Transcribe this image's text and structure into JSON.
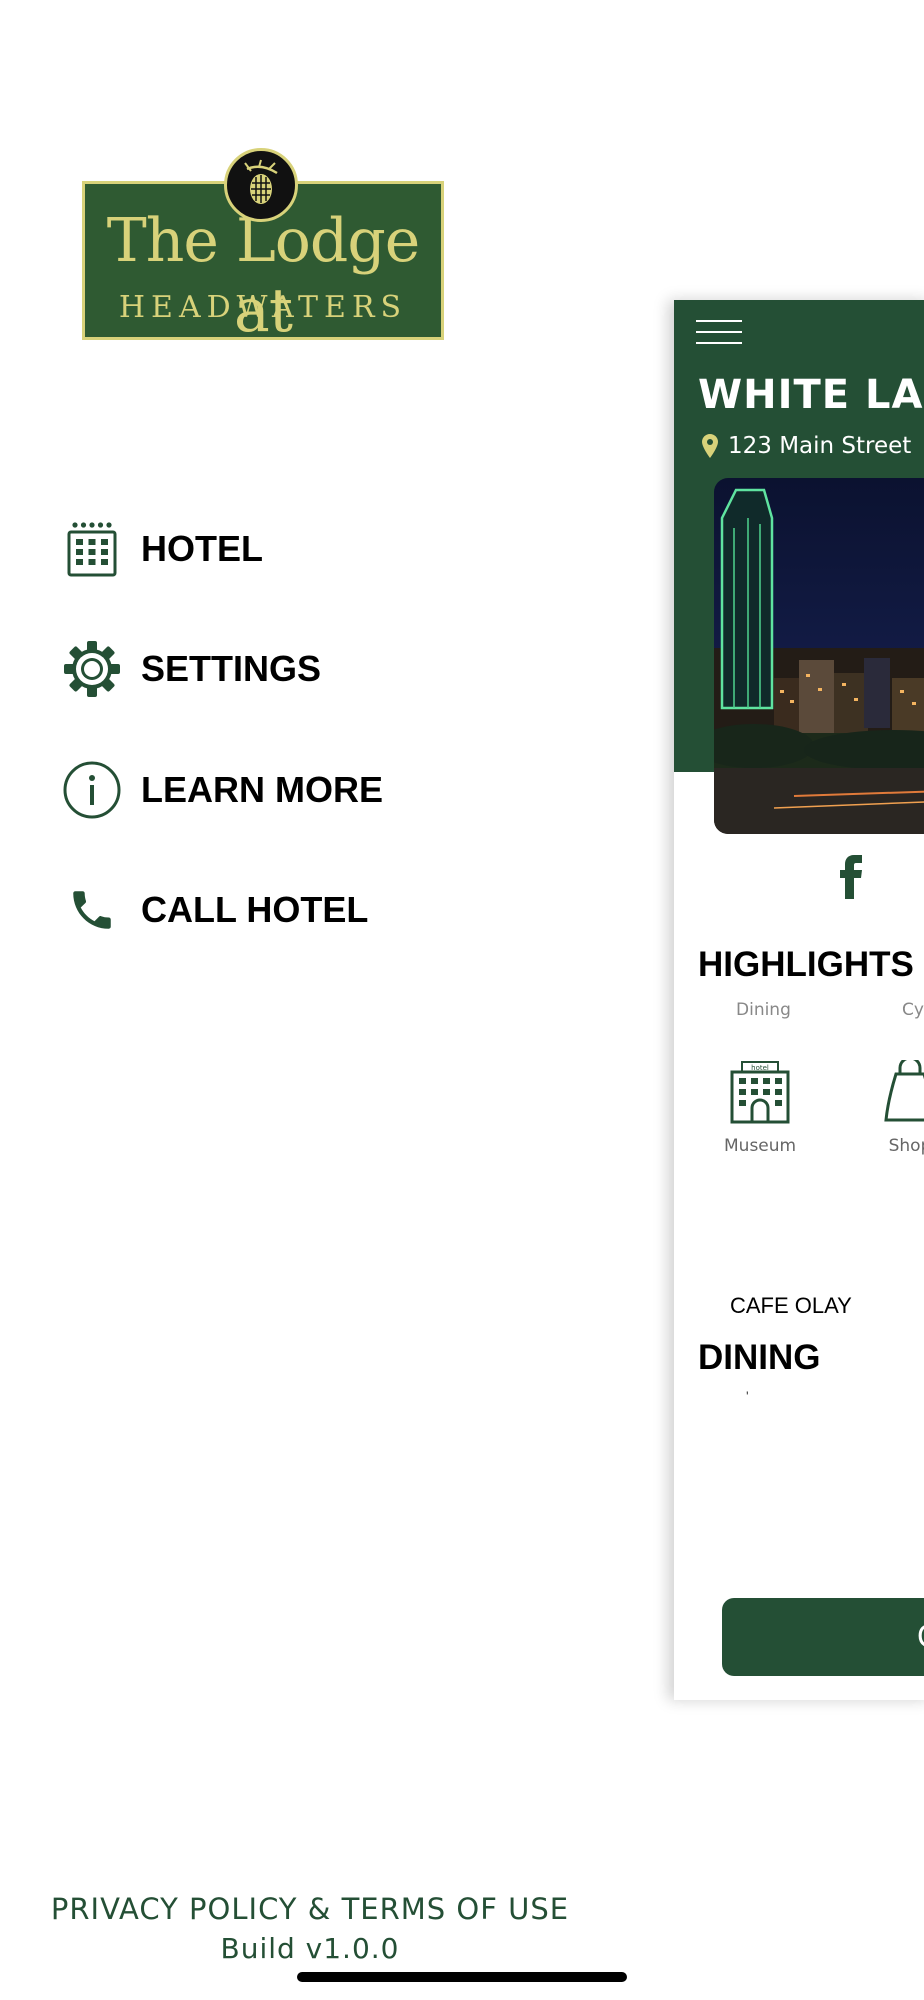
{
  "logo": {
    "line1": "The Lodge at",
    "line2": "HEADWATERS"
  },
  "menu": {
    "items": [
      {
        "label": "HOTEL",
        "icon": "hotel-building-icon"
      },
      {
        "label": "SETTINGS",
        "icon": "gear-icon"
      },
      {
        "label": "LEARN MORE",
        "icon": "info-icon"
      },
      {
        "label": "CALL HOTEL",
        "icon": "phone-icon"
      }
    ]
  },
  "footer": {
    "privacy": "PRIVACY POLICY",
    "amp": "&",
    "terms": "TERMS OF USE",
    "build": "Build v1.0.0"
  },
  "panel": {
    "hotel_name": "WHITE LAB",
    "address": "123 Main Street",
    "highlights_title": "HIGHLIGHTS",
    "cut_labels": [
      "Dining",
      "Cy"
    ],
    "highlights": [
      {
        "label": "Museum",
        "icon": "hotel-building-icon",
        "sign": "hotel"
      },
      {
        "label": "Shop",
        "icon": "shopping-bag-icon"
      }
    ],
    "cafe": "CAFE OLAY",
    "dining_title": "DINING",
    "tick": "'",
    "button_label": "C"
  },
  "colors": {
    "brand_green": "#244f35",
    "logo_green": "#2f5a32",
    "logo_gold": "#d8d27a"
  }
}
